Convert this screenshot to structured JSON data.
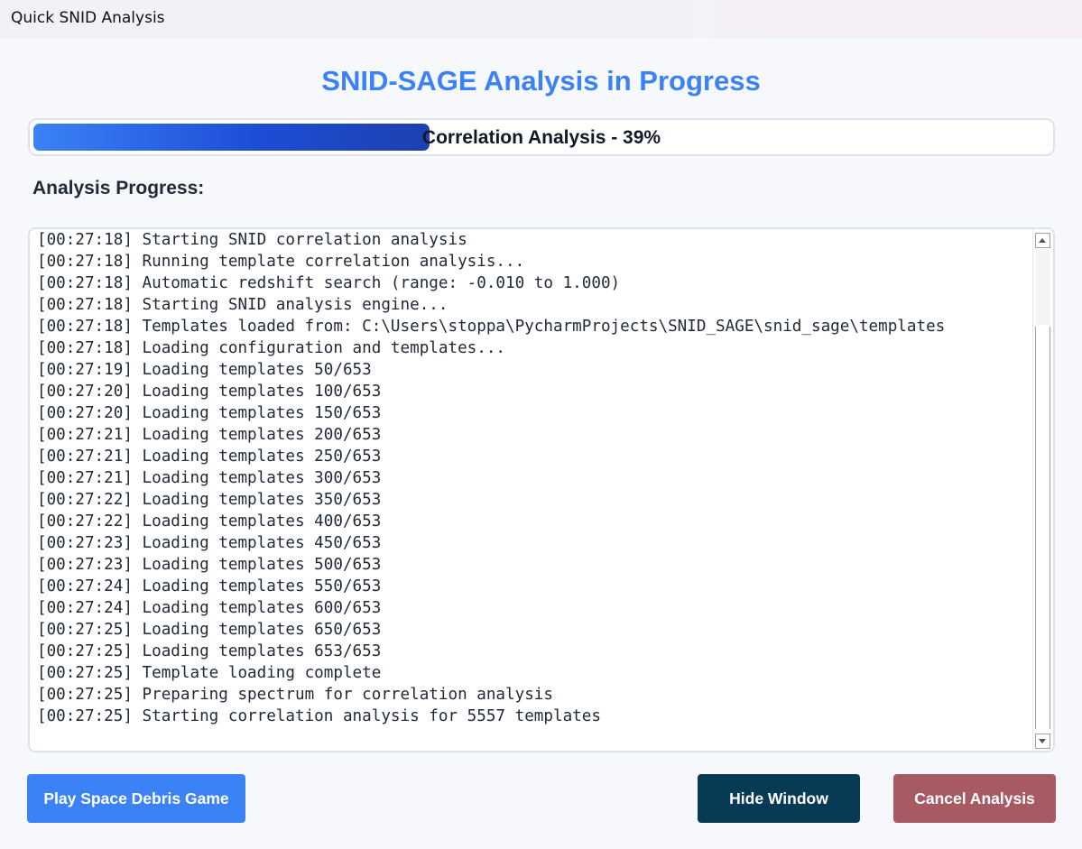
{
  "window": {
    "title": "Quick SNID Analysis"
  },
  "header": {
    "title": "SNID-SAGE Analysis in Progress"
  },
  "progress": {
    "label": "Correlation Analysis - 39%",
    "fraction": 0.39,
    "color_start": "#3b82f6",
    "color_end": "#1e40af"
  },
  "log": {
    "heading": "Analysis Progress:",
    "lines": [
      "[00:27:18] Starting SNID correlation analysis",
      "[00:27:18] Running template correlation analysis...",
      "[00:27:18] Automatic redshift search (range: -0.010 to 1.000)",
      "[00:27:18] Starting SNID analysis engine...",
      "[00:27:18] Templates loaded from: C:\\Users\\stoppa\\PycharmProjects\\SNID_SAGE\\snid_sage\\templates",
      "[00:27:18] Loading configuration and templates...",
      "[00:27:19] Loading templates 50/653",
      "[00:27:20] Loading templates 100/653",
      "[00:27:20] Loading templates 150/653",
      "[00:27:21] Loading templates 200/653",
      "[00:27:21] Loading templates 250/653",
      "[00:27:21] Loading templates 300/653",
      "[00:27:22] Loading templates 350/653",
      "[00:27:22] Loading templates 400/653",
      "[00:27:23] Loading templates 450/653",
      "[00:27:23] Loading templates 500/653",
      "[00:27:24] Loading templates 550/653",
      "[00:27:24] Loading templates 600/653",
      "[00:27:25] Loading templates 650/653",
      "[00:27:25] Loading templates 653/653",
      "[00:27:25] Template loading complete",
      "[00:27:25] Preparing spectrum for correlation analysis",
      "[00:27:25] Starting correlation analysis for 5557 templates"
    ]
  },
  "buttons": {
    "game": {
      "label": "Play Space Debris Game",
      "color": "#3b82f6"
    },
    "hide": {
      "label": "Hide Window",
      "color": "#073b55"
    },
    "cancel": {
      "label": "Cancel Analysis",
      "color": "#a85a64"
    }
  }
}
